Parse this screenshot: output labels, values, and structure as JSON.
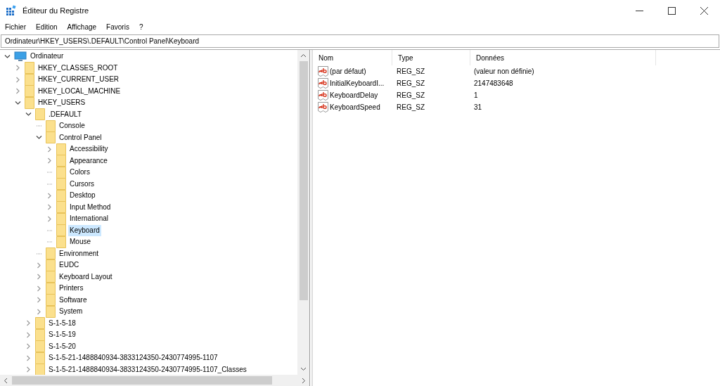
{
  "window": {
    "title": "Éditeur du Registre"
  },
  "menu": [
    "Fichier",
    "Edition",
    "Affichage",
    "Favoris",
    "?"
  ],
  "address": "Ordinateur\\HKEY_USERS\\.DEFAULT\\Control Panel\\Keyboard",
  "tree": [
    {
      "label": "Ordinateur",
      "kind": "computer",
      "expanded": true,
      "selected": false,
      "children": [
        {
          "label": "HKEY_CLASSES_ROOT",
          "kind": "branch",
          "expanded": false,
          "selected": false
        },
        {
          "label": "HKEY_CURRENT_USER",
          "kind": "branch",
          "expanded": false,
          "selected": false
        },
        {
          "label": "HKEY_LOCAL_MACHINE",
          "kind": "branch",
          "expanded": false,
          "selected": false
        },
        {
          "label": "HKEY_USERS",
          "kind": "branch",
          "expanded": true,
          "selected": false,
          "children": [
            {
              "label": ".DEFAULT",
              "kind": "branch",
              "expanded": true,
              "selected": false,
              "children": [
                {
                  "label": "Console",
                  "kind": "leaf",
                  "selected": false
                },
                {
                  "label": "Control Panel",
                  "kind": "branch",
                  "expanded": true,
                  "selected": false,
                  "children": [
                    {
                      "label": "Accessibility",
                      "kind": "branch",
                      "expanded": false,
                      "selected": false
                    },
                    {
                      "label": "Appearance",
                      "kind": "branch",
                      "expanded": false,
                      "selected": false
                    },
                    {
                      "label": "Colors",
                      "kind": "leaf",
                      "selected": false
                    },
                    {
                      "label": "Cursors",
                      "kind": "leaf",
                      "selected": false
                    },
                    {
                      "label": "Desktop",
                      "kind": "branch",
                      "expanded": false,
                      "selected": false
                    },
                    {
                      "label": "Input Method",
                      "kind": "branch",
                      "expanded": false,
                      "selected": false
                    },
                    {
                      "label": "International",
                      "kind": "branch",
                      "expanded": false,
                      "selected": false
                    },
                    {
                      "label": "Keyboard",
                      "kind": "leaf",
                      "selected": true
                    },
                    {
                      "label": "Mouse",
                      "kind": "leaf",
                      "selected": false
                    }
                  ]
                },
                {
                  "label": "Environment",
                  "kind": "leaf",
                  "selected": false
                },
                {
                  "label": "EUDC",
                  "kind": "branch",
                  "expanded": false,
                  "selected": false
                },
                {
                  "label": "Keyboard Layout",
                  "kind": "branch",
                  "expanded": false,
                  "selected": false
                },
                {
                  "label": "Printers",
                  "kind": "branch",
                  "expanded": false,
                  "selected": false
                },
                {
                  "label": "Software",
                  "kind": "branch",
                  "expanded": false,
                  "selected": false
                },
                {
                  "label": "System",
                  "kind": "branch",
                  "expanded": false,
                  "selected": false
                }
              ]
            },
            {
              "label": "S-1-5-18",
              "kind": "branch",
              "expanded": false,
              "selected": false
            },
            {
              "label": "S-1-5-19",
              "kind": "branch",
              "expanded": false,
              "selected": false
            },
            {
              "label": "S-1-5-20",
              "kind": "branch",
              "expanded": false,
              "selected": false
            },
            {
              "label": "S-1-5-21-1488840934-3833124350-2430774995-1107",
              "kind": "branch",
              "expanded": false,
              "selected": false
            },
            {
              "label": "S-1-5-21-1488840934-3833124350-2430774995-1107_Classes",
              "kind": "branch",
              "expanded": false,
              "selected": false
            }
          ]
        }
      ]
    }
  ],
  "table": {
    "columns": [
      "Nom",
      "Type",
      "Données"
    ],
    "rows": [
      {
        "name": "(par défaut)",
        "type": "REG_SZ",
        "data": "(valeur non définie)"
      },
      {
        "name": "InitialKeyboardI...",
        "type": "REG_SZ",
        "data": "2147483648"
      },
      {
        "name": "KeyboardDelay",
        "type": "REG_SZ",
        "data": "1"
      },
      {
        "name": "KeyboardSpeed",
        "type": "REG_SZ",
        "data": "31"
      }
    ]
  }
}
